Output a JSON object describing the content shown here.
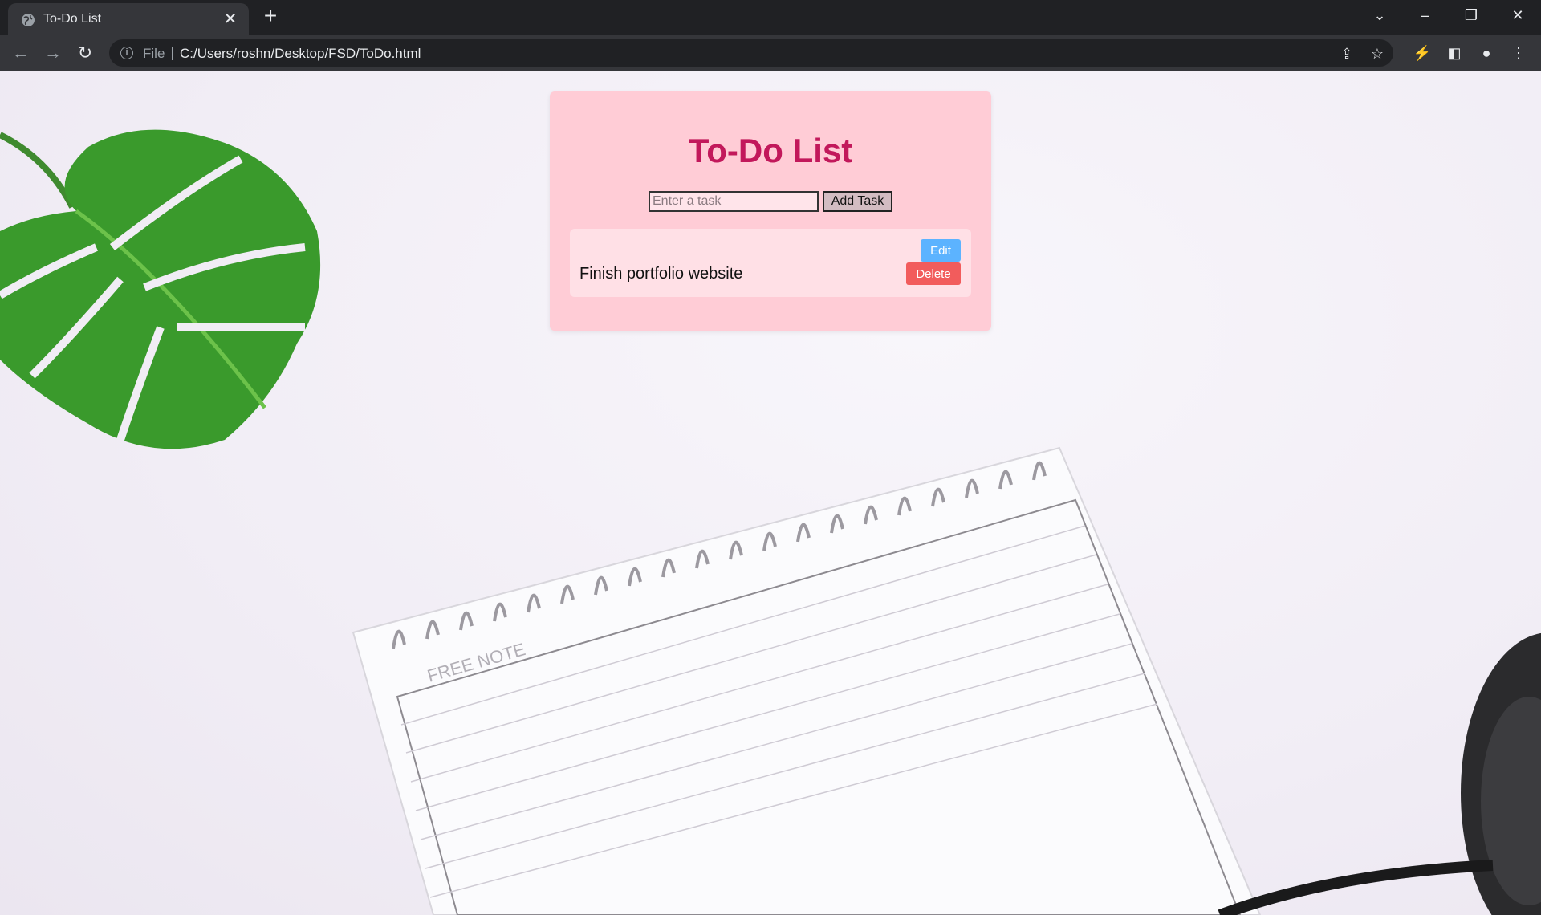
{
  "browser": {
    "tab_title": "To-Do List",
    "url_scheme": "File",
    "url": "C:/Users/roshn/Desktop/FSD/ToDo.html",
    "icons": {
      "favicon": "globe-icon",
      "tab_close": "close-icon",
      "new_tab": "plus-icon",
      "tab_search": "chevron-down-icon",
      "minimize": "minimize-icon",
      "restore": "restore-icon",
      "window_close": "close-icon",
      "back": "back-arrow-icon",
      "forward": "forward-arrow-icon",
      "reload": "reload-icon",
      "site_info": "info-icon",
      "share": "share-icon",
      "bookmark": "star-icon",
      "extensions": "extension-icon",
      "side_panel": "side-panel-icon",
      "profile": "profile-icon",
      "menu": "kebab-menu-icon"
    }
  },
  "app": {
    "title": "To-Do List",
    "input_placeholder": "Enter a task",
    "input_value": "",
    "add_button_label": "Add Task",
    "tasks": [
      {
        "text": "Finish portfolio website",
        "edit_label": "Edit",
        "delete_label": "Delete"
      }
    ],
    "colors": {
      "card_bg": "#ffccd6",
      "title": "#c2185b",
      "edit_button": "#5cb3ff",
      "delete_button": "#f25c5c",
      "task_bg": "#ffe0e6"
    }
  },
  "background": {
    "notebook_label": "FREE NOTE"
  }
}
